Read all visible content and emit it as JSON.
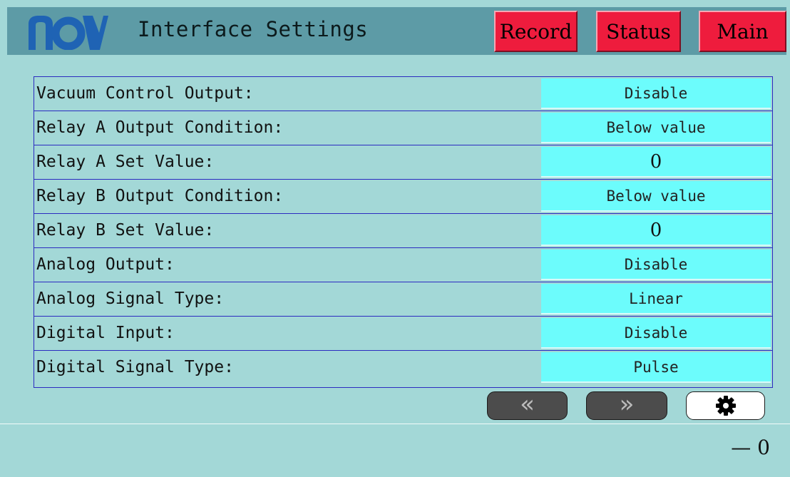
{
  "header": {
    "logo": "nai-logo",
    "title": "Interface Settings",
    "nav": {
      "record": "Record",
      "status": "Status",
      "main": "Main"
    }
  },
  "settings": {
    "rows": [
      {
        "label": "Vacuum Control Output:",
        "value": "Disable"
      },
      {
        "label": "Relay A Output Condition:",
        "value": "Below value"
      },
      {
        "label": "Relay A Set Value:",
        "value": "0"
      },
      {
        "label": "Relay B Output Condition:",
        "value": "Below value"
      },
      {
        "label": "Relay B Set Value:",
        "value": "0"
      },
      {
        "label": "Analog Output:",
        "value": "Disable"
      },
      {
        "label": "Analog Signal Type:",
        "value": "Linear"
      },
      {
        "label": "Digital Input:",
        "value": "Disable"
      },
      {
        "label": "Digital Signal Type:",
        "value": "Pulse"
      }
    ]
  },
  "pager": {
    "prev_glyph": "«",
    "next_glyph": "»",
    "prev_icon": "double-chevron-left-icon",
    "next_icon": "double-chevron-right-icon",
    "settings_icon": "gear-icon"
  },
  "footer": {
    "readout": "— 0"
  },
  "colors": {
    "background": "#a3d8d7",
    "header": "#5d9ba6",
    "nav_button": "#ee1c3d",
    "value_cell": "#6cfcfc",
    "table_border": "#2b2bc0",
    "logo_blue": "#1f63b4"
  }
}
